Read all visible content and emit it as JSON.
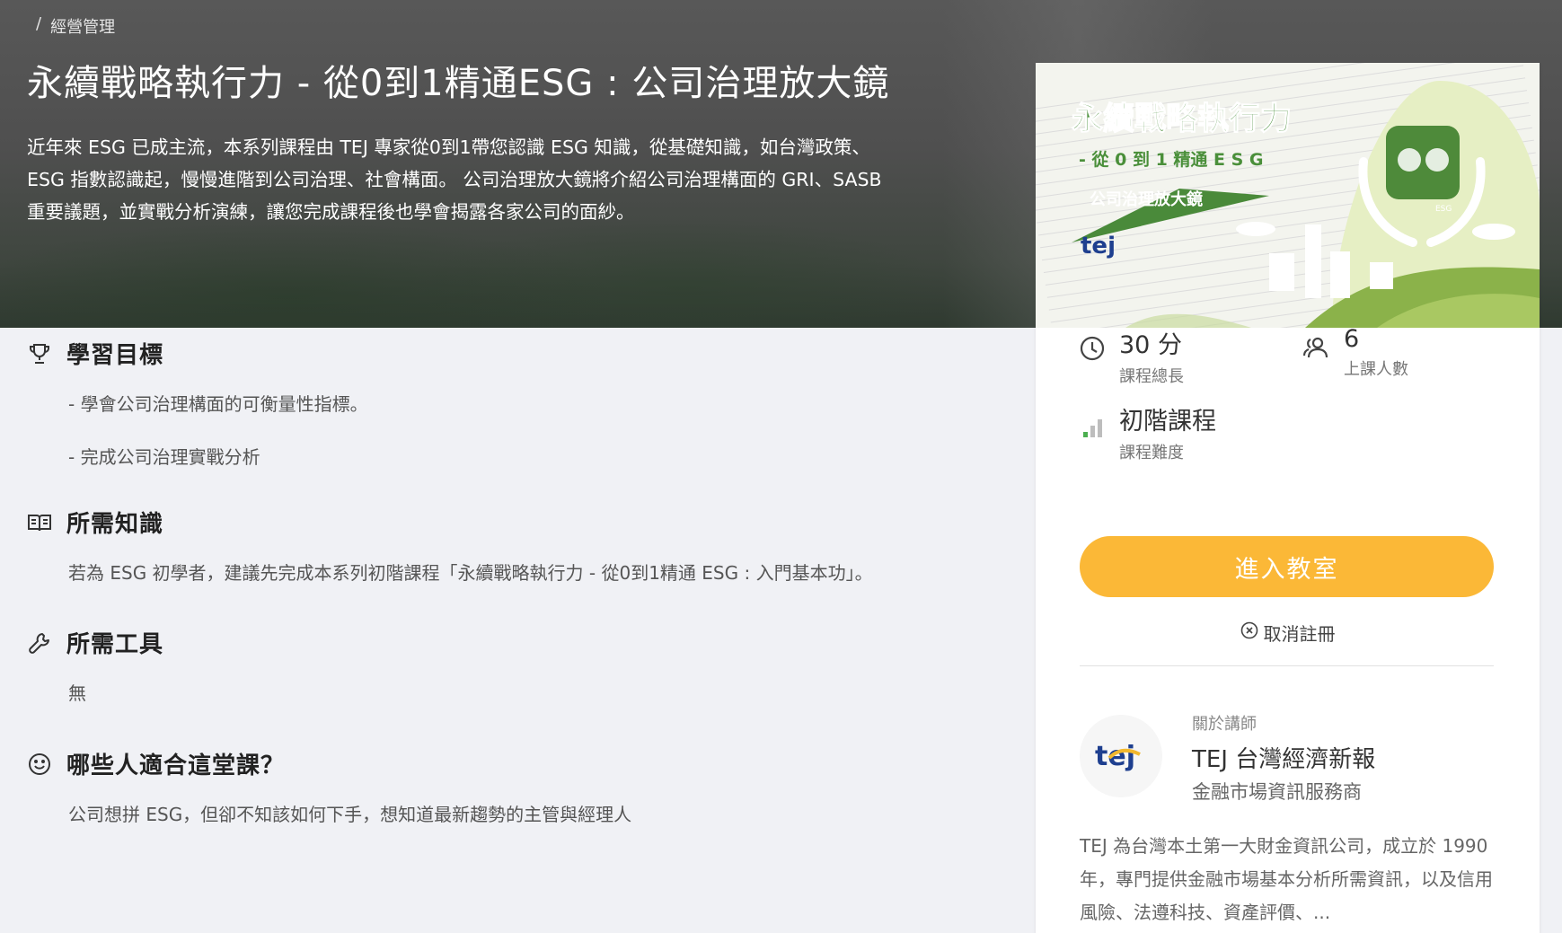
{
  "breadcrumb": {
    "separator": "/",
    "current": "經營管理"
  },
  "course": {
    "title": "永續戰略執行力 - 從0到1精通ESG : 公司治理放大鏡",
    "description": "近年來 ESG 已成主流，本系列課程由 TEJ 專家從0到1帶您認識 ESG 知識，從基礎知識，如台灣政策、ESG 指數認識起，慢慢進階到公司治理、社會構面。 公司治理放大鏡將介紹公司治理構面的 GRI、SASB 重要議題，並實戰分析演練，讓您完成課程後也學會揭露各家公司的面紗。"
  },
  "sections": {
    "goals": {
      "title": "學習目標",
      "items": [
        "- 學會公司治理構面的可衡量性指標。",
        "- 完成公司治理實戰分析"
      ]
    },
    "knowledge": {
      "title": "所需知識",
      "text": "若為 ESG 初學者，建議先完成本系列初階課程「永續戰略執行力 - 從0到1精通 ESG : 入門基本功」。"
    },
    "tools": {
      "title": "所需工具",
      "text": "無"
    },
    "audience": {
      "title": "哪些人適合這堂課？",
      "text": "公司想拼 ESG，但卻不知該如何下手，想知道最新趨勢的主管與經理人"
    }
  },
  "banner": {
    "title": "永續戰略執行力",
    "subtitle": "- 從 0 到 1 精通 E S G",
    "tag": "公司治理放大鏡",
    "brand": "tej",
    "badge": "ESG"
  },
  "stats": {
    "duration": {
      "value": "30 分",
      "label": "課程總長",
      "icon": "clock-icon"
    },
    "students": {
      "value": "6",
      "label": "上課人數",
      "icon": "users-icon"
    },
    "level": {
      "value": "初階課程",
      "label": "課程難度",
      "icon": "signal-bars-icon"
    }
  },
  "actions": {
    "enter": "進入教室",
    "unenroll": "取消註冊"
  },
  "instructor": {
    "caption": "關於講師",
    "name": "TEJ 台灣經濟新報",
    "role": "金融市場資訊服務商",
    "logo": "tej",
    "bio": "TEJ 為台灣本土第一大財金資訊公司，成立於 1990 年，專門提供金融市場基本分析所需資訊，以及信用風險、法遵科技、資產評價、..."
  },
  "colors": {
    "accent": "#fbb837",
    "green": "#6a9a3a",
    "brand_blue": "#1e3f8f",
    "brand_yellow": "#f2b82e"
  }
}
